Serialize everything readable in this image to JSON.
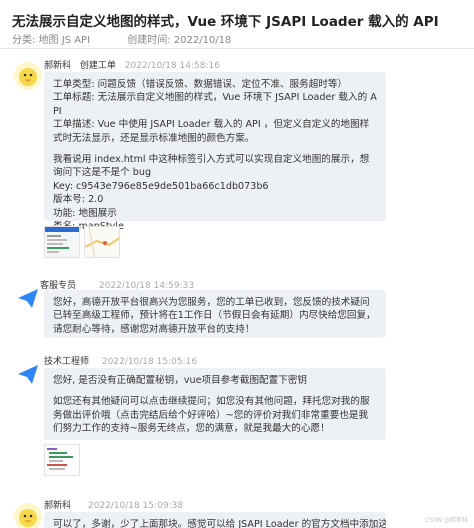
{
  "title": "无法展示自定义地图的样式，Vue 环境下 JSAPI Loader 载入的 API",
  "meta": {
    "category": "分类: 地图 JS API",
    "created": "创建时间: 2022/10/18"
  },
  "messages": [
    {
      "author": "郝新科",
      "role": "创建工单",
      "time": "2022/10/18 14:58:16",
      "lines": [
        "工单类型: 问题反馈（错误反馈、数据错误、定位不准、服务超时等）",
        "工单标题: 无法展示自定义地图的样式，Vue 环境下 JSAPI Loader 载入的 API",
        "工单描述: Vue 中使用 JSAPI Loader 载入的 API ，但定义自定义的地图样式时无法显示，还是显示标准地图的颜色方案。",
        "",
        "我看说用 index.html 中这种标签引入方式可以实现自定义地图的展示，想询问下这是不是个 bug",
        "Key: c9543e796e85e9de501ba66c1db073b6",
        "版本号: 2.0",
        "功能: 地图展示",
        "类名: mapStyle"
      ]
    },
    {
      "author": "客服专员",
      "role": "",
      "time": "2022/10/18 14:59:33",
      "lines": [
        "您好，高德开放平台很高兴为您服务，您的工单已收到，您反馈的技术疑问已转至高级工程师，预计将在1工作日（节假日会有延期）内尽快给您回复，请您耐心等待，感谢您对高德开放平台的支持！"
      ]
    },
    {
      "author": "技术工程师",
      "role": "",
      "time": "2022/10/18 15:05:16",
      "lines": [
        "您好, 是否没有正确配置秘钥，vue项目参考截图配置下密钥",
        "",
        "如您还有其他疑问可以点击继续提问；如您没有其他问题，拜托您对我的服务做出评价哦（点击完结后给个好评哈）~您的评价对我们非常重要也是我们努力工作的支持~服务无终点，您的满意，就是我最大的心愿！"
      ]
    },
    {
      "author": "郝新科",
      "role": "",
      "time": "2022/10/18 15:09:38",
      "lines": [
        "可以了，多谢，少了上面那块。感觉可以给 JSAPI Loader 的官方文档中添加这部分代"
      ]
    }
  ],
  "watermark": "CSDN @郝新科"
}
